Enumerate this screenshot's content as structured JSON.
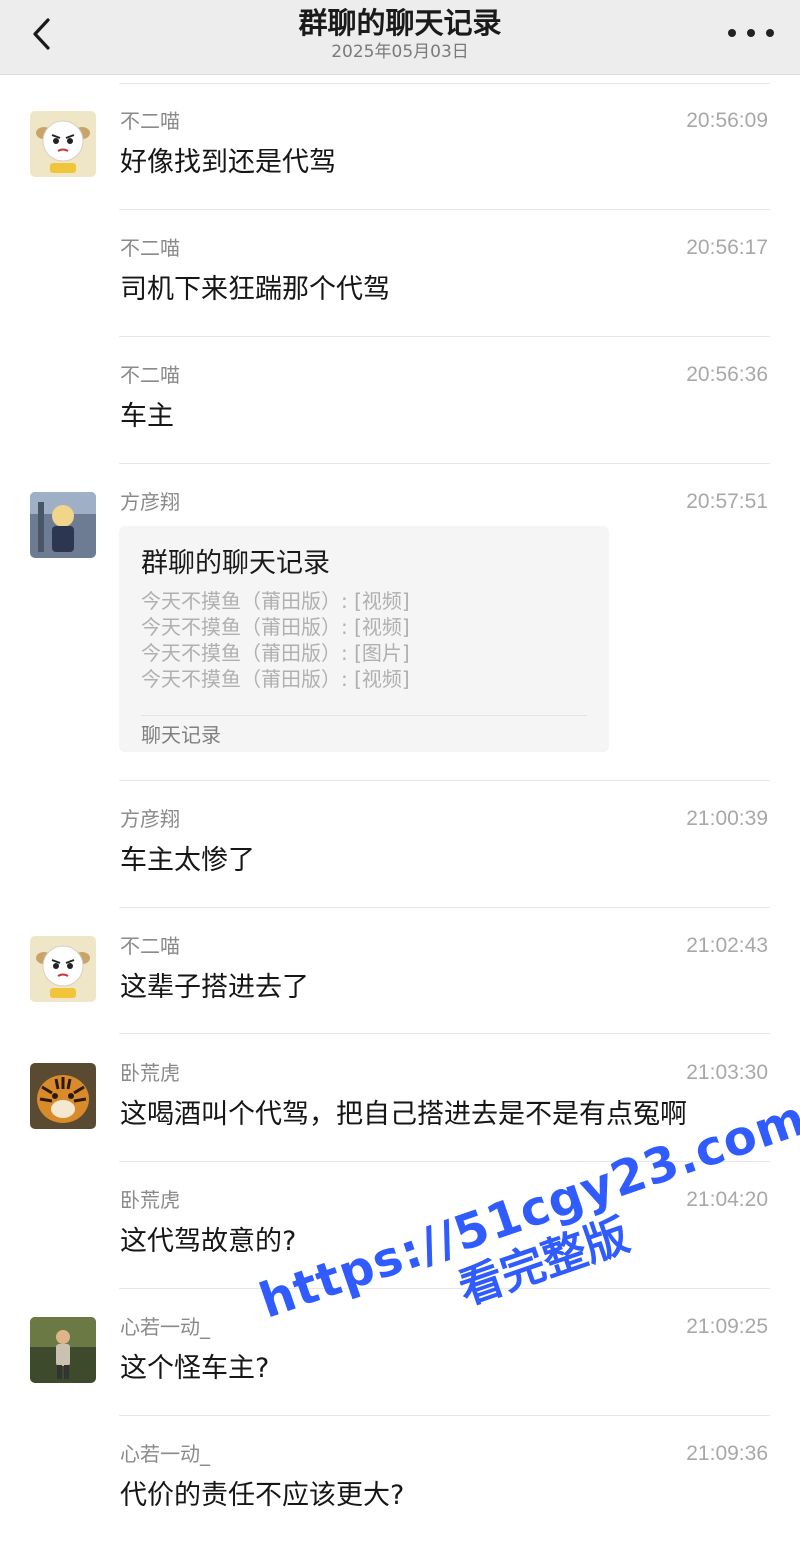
{
  "header": {
    "title": "群聊的聊天记录",
    "date": "2025年05月03日"
  },
  "messages": [
    {
      "sender": "不二喵",
      "time": "20:56:09",
      "text": "好像找到还是代驾",
      "avatar": "sheep-avatar"
    },
    {
      "sender": "不二喵",
      "time": "20:56:17",
      "text": "司机下来狂踹那个代驾"
    },
    {
      "sender": "不二喵",
      "time": "20:56:36",
      "text": "车主"
    },
    {
      "sender": "方彦翔",
      "time": "20:57:51",
      "avatar": "anime-avatar"
    },
    {
      "sender": "方彦翔",
      "time": "21:00:39",
      "text": "车主太惨了"
    },
    {
      "sender": "不二喵",
      "time": "21:02:43",
      "text": "这辈子搭进去了",
      "avatar": "sheep-avatar"
    },
    {
      "sender": "卧荒虎",
      "time": "21:03:30",
      "text": "这喝酒叫个代驾，把自己搭进去是不是有点冤啊",
      "avatar": "tiger-avatar"
    },
    {
      "sender": "卧荒虎",
      "time": "21:04:20",
      "text": "这代驾故意的?"
    },
    {
      "sender": "心若一动_",
      "time": "21:09:25",
      "text": "这个怪车主?",
      "avatar": "person-avatar"
    },
    {
      "sender": "心若一动_",
      "time": "21:09:36",
      "text": "代价的责任不应该更大?"
    }
  ],
  "card": {
    "title": "群聊的聊天记录",
    "lines": [
      "今天不摸鱼（莆田版）: [视频]",
      "今天不摸鱼（莆田版）: [视频]",
      "今天不摸鱼（莆田版）: [图片]",
      "今天不摸鱼（莆田版）: [视频]"
    ],
    "footer": "聊天记录"
  },
  "watermark": {
    "url": "https://51cgy23.com",
    "caption": "看完整版"
  },
  "icons": {
    "back": "chevron-left-icon",
    "more": "more-dots-icon"
  }
}
